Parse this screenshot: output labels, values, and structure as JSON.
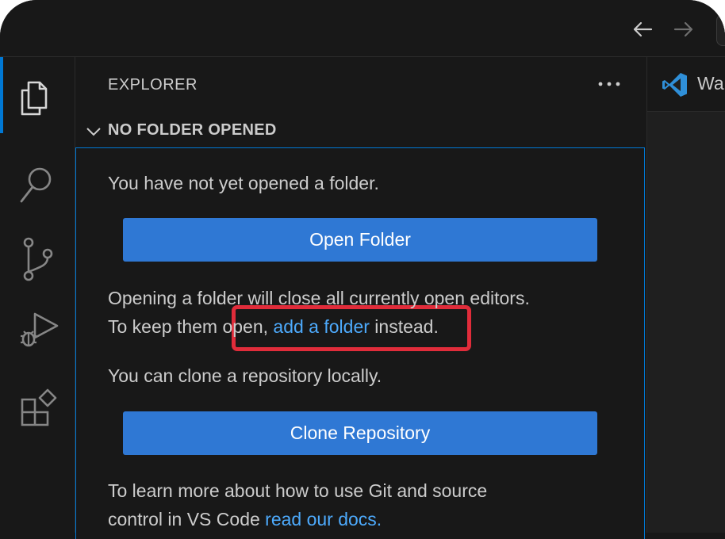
{
  "titlebar": {
    "back_icon": "arrow-left-icon",
    "forward_icon": "arrow-right-icon"
  },
  "activity_bar": {
    "items": [
      {
        "icon": "files-icon",
        "active": true
      },
      {
        "icon": "search-icon"
      },
      {
        "icon": "source-control-icon"
      },
      {
        "icon": "run-debug-icon"
      },
      {
        "icon": "extensions-icon"
      }
    ]
  },
  "sidebar": {
    "title": "EXPLORER",
    "more_icon": "ellipsis-icon",
    "section": {
      "title": "NO FOLDER OPENED",
      "line1": "You have not yet opened a folder.",
      "open_folder_label": "Open Folder",
      "line2": "Opening a folder will close all currently open editors.",
      "line3_prefix": "To keep them open,",
      "line3_link": "add a folder",
      "line3_suffix": "instead.",
      "line4": "You can clone a repository locally.",
      "clone_label": "Clone Repository",
      "line5": "To learn more about how to use Git and source",
      "line6_prefix": "control in VS Code",
      "line6_link": "read our docs."
    }
  },
  "editor": {
    "tab_label": "Wa",
    "tab_icon": "vscode-icon"
  },
  "colors": {
    "accent": "#0078d4",
    "button": "#2f78d4",
    "link": "#4daafc",
    "highlight": "#e02c3a"
  }
}
